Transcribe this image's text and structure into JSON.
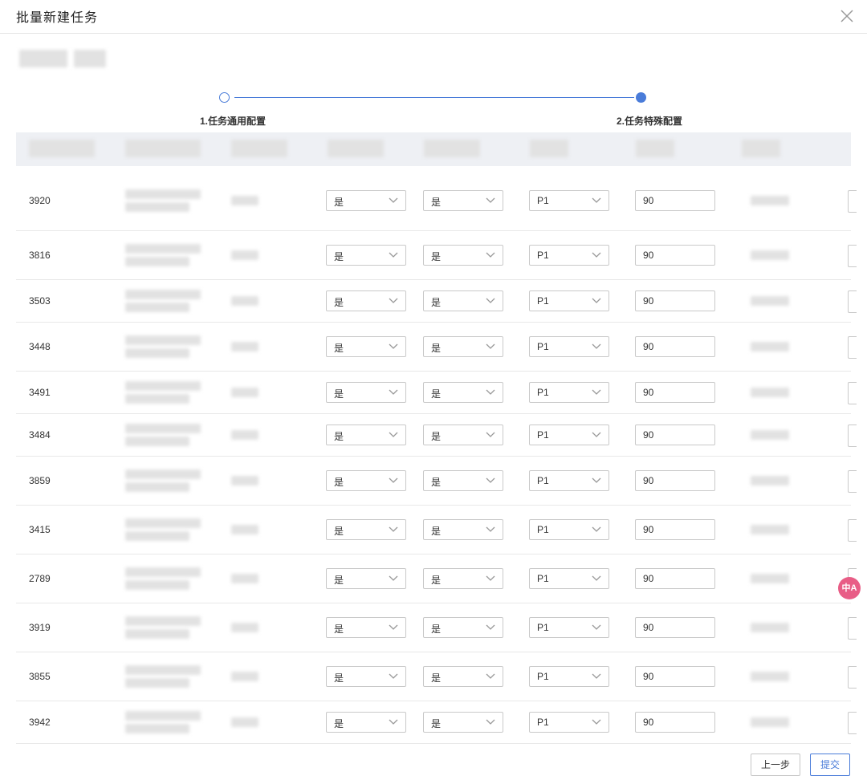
{
  "dialog": {
    "title": "批量新建任务"
  },
  "steps": [
    {
      "label": "1.任务通用配置"
    },
    {
      "label": "2.任务特殊配置"
    }
  ],
  "rows": [
    {
      "id": "3920",
      "col1": "是",
      "col2": "是",
      "priority": "P1",
      "days": "90"
    },
    {
      "id": "3816",
      "col1": "是",
      "col2": "是",
      "priority": "P1",
      "days": "90"
    },
    {
      "id": "3503",
      "col1": "是",
      "col2": "是",
      "priority": "P1",
      "days": "90"
    },
    {
      "id": "3448",
      "col1": "是",
      "col2": "是",
      "priority": "P1",
      "days": "90"
    },
    {
      "id": "3491",
      "col1": "是",
      "col2": "是",
      "priority": "P1",
      "days": "90"
    },
    {
      "id": "3484",
      "col1": "是",
      "col2": "是",
      "priority": "P1",
      "days": "90"
    },
    {
      "id": "3859",
      "col1": "是",
      "col2": "是",
      "priority": "P1",
      "days": "90"
    },
    {
      "id": "3415",
      "col1": "是",
      "col2": "是",
      "priority": "P1",
      "days": "90"
    },
    {
      "id": "2789",
      "col1": "是",
      "col2": "是",
      "priority": "P1",
      "days": "90"
    },
    {
      "id": "3919",
      "col1": "是",
      "col2": "是",
      "priority": "P1",
      "days": "90"
    },
    {
      "id": "3855",
      "col1": "是",
      "col2": "是",
      "priority": "P1",
      "days": "90"
    },
    {
      "id": "3942",
      "col1": "是",
      "col2": "是",
      "priority": "P1",
      "days": "90"
    }
  ],
  "footer": {
    "prev_label": "上一步",
    "submit_label": "提交"
  },
  "translate_badge": {
    "label": "中A"
  },
  "icons": {
    "close": "close-icon",
    "chevron": "chevron-down-icon"
  },
  "colors": {
    "primary": "#4a7cd9",
    "badge": "#e85d86"
  }
}
